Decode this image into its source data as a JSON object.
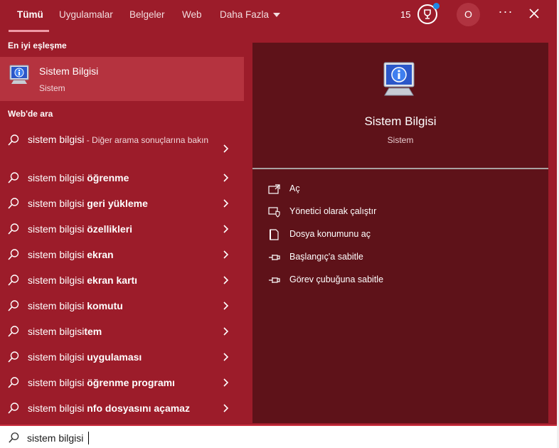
{
  "tabs": [
    {
      "label": "Tümü",
      "active": true
    },
    {
      "label": "Uygulamalar"
    },
    {
      "label": "Belgeler"
    },
    {
      "label": "Web"
    },
    {
      "label": "Daha Fazla"
    }
  ],
  "header": {
    "reward_count": "15",
    "avatar_initial": "O",
    "more_label": "···",
    "icons": [
      "rewards-icon",
      "notification-dot",
      "avatar",
      "more-options-icon",
      "close-icon"
    ]
  },
  "best_match": {
    "section_label": "En iyi eşleşme",
    "title": "Sistem Bilgisi",
    "subtitle": "Sistem"
  },
  "web": {
    "section_label": "Web'de ara",
    "first": {
      "prefix": "sistem bilgisi",
      "note": " - Diğer arama sonuçlarına bakın"
    },
    "suggestions": [
      {
        "prefix": "sistem bilgisi ",
        "suffix": "öğrenme"
      },
      {
        "prefix": "sistem bilgisi ",
        "suffix": "geri yükleme"
      },
      {
        "prefix": "sistem bilgisi ",
        "suffix": "özellikleri"
      },
      {
        "prefix": "sistem bilgisi ",
        "suffix": "ekran"
      },
      {
        "prefix": "sistem bilgisi ",
        "suffix": "ekran kartı"
      },
      {
        "prefix": "sistem bilgisi ",
        "suffix": "komutu"
      },
      {
        "prefix": "sistem bilgisi",
        "suffix": "tem"
      },
      {
        "prefix": "sistem bilgisi ",
        "suffix": "uygulaması"
      },
      {
        "prefix": "sistem bilgisi ",
        "suffix": "öğrenme programı"
      },
      {
        "prefix": "sistem bilgisi ",
        "suffix": "nfo dosyasını açamaz"
      }
    ]
  },
  "preview": {
    "title": "Sistem Bilgisi",
    "subtitle": "Sistem",
    "actions": [
      {
        "label": "Aç",
        "icon": "open-icon"
      },
      {
        "label": "Yönetici olarak çalıştır",
        "icon": "admin-shield-icon"
      },
      {
        "label": "Dosya konumunu aç",
        "icon": "file-location-icon"
      },
      {
        "label": "Başlangıç'a sabitle",
        "icon": "pin-start-icon"
      },
      {
        "label": "Görev çubuğuna sabitle",
        "icon": "pin-taskbar-icon"
      }
    ]
  },
  "search": {
    "value": "sistem bilgisi"
  },
  "colors": {
    "background": "#9c1c2a",
    "selected_row": "#b5333f",
    "preview_panel": "#5e1219",
    "accent_underline": "#ee9aa6",
    "notification_dot": "#1e88e5"
  }
}
